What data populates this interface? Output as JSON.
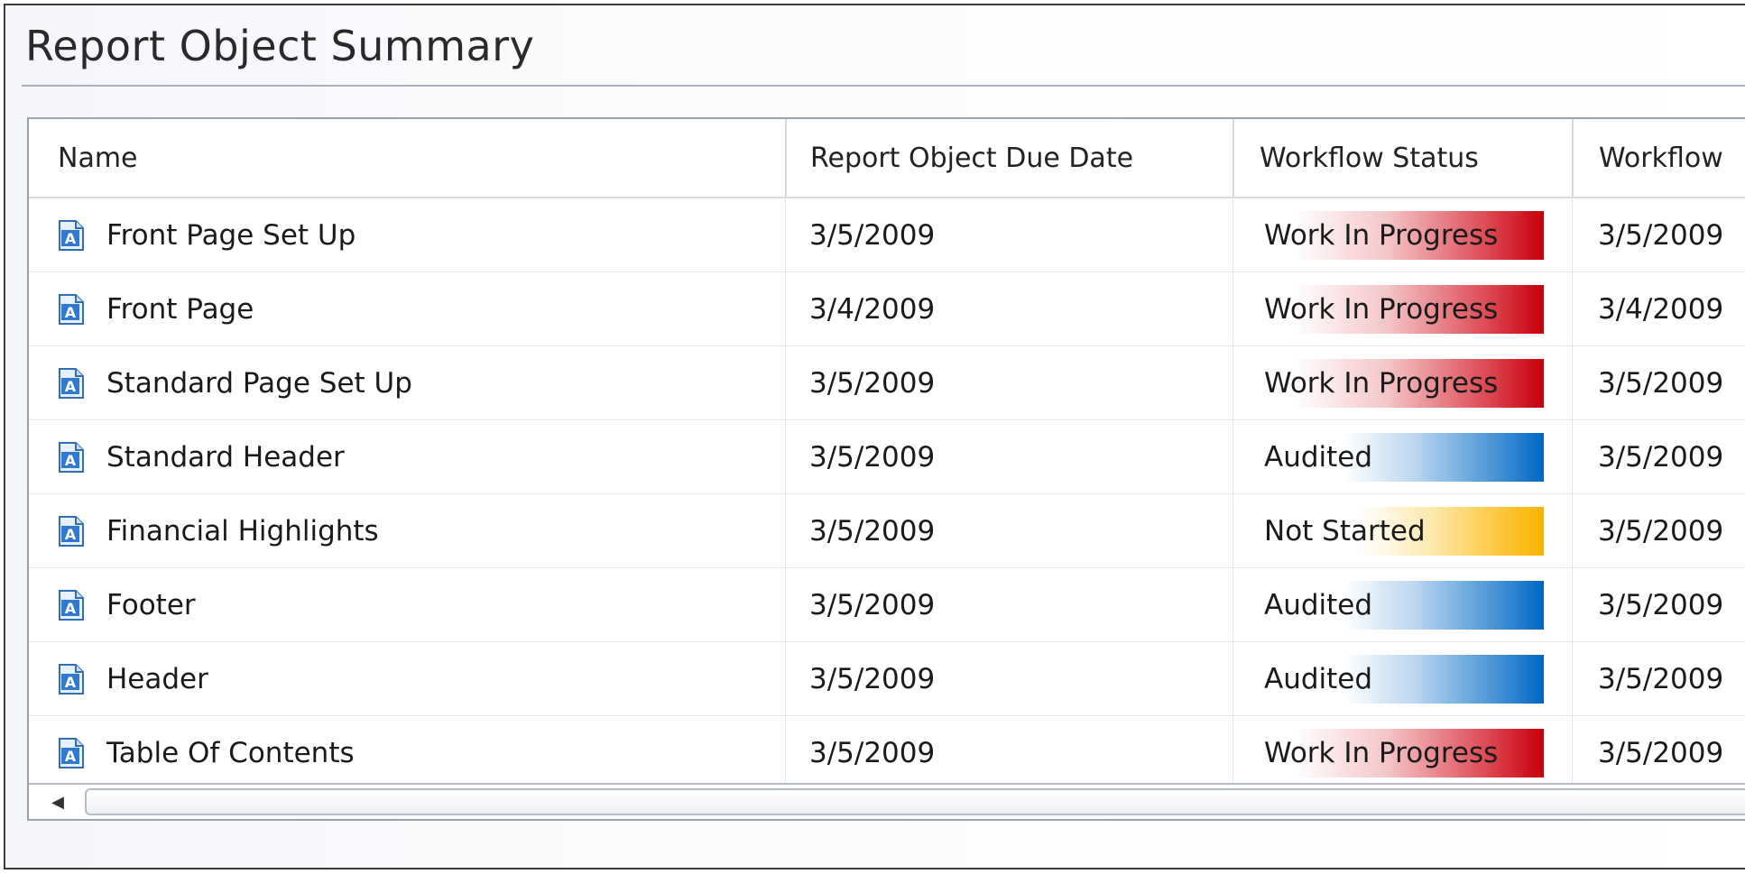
{
  "panel": {
    "title": "Report Object Summary"
  },
  "columns": {
    "name": "Name",
    "due_date": "Report Object Due Date",
    "status": "Workflow Status",
    "workflow": "Workflow"
  },
  "rows": [
    {
      "name": "Front Page Set Up",
      "due_date": "3/5/2009",
      "status": "Work In Progress",
      "workflow": "3/5/2009",
      "status_color": "#c4000b"
    },
    {
      "name": "Front Page",
      "due_date": "3/4/2009",
      "status": "Work In Progress",
      "workflow": "3/4/2009",
      "status_color": "#c4000b"
    },
    {
      "name": "Standard Page Set Up",
      "due_date": "3/5/2009",
      "status": "Work In Progress",
      "workflow": "3/5/2009",
      "status_color": "#c4000b"
    },
    {
      "name": "Standard Header",
      "due_date": "3/5/2009",
      "status": "Audited",
      "workflow": "3/5/2009",
      "status_color": "#0066c2"
    },
    {
      "name": "Financial Highlights",
      "due_date": "3/5/2009",
      "status": "Not Started",
      "workflow": "3/5/2009",
      "status_color": "#f7b400"
    },
    {
      "name": "Footer",
      "due_date": "3/5/2009",
      "status": "Audited",
      "workflow": "3/5/2009",
      "status_color": "#0066c2"
    },
    {
      "name": "Header",
      "due_date": "3/5/2009",
      "status": "Audited",
      "workflow": "3/5/2009",
      "status_color": "#0066c2"
    },
    {
      "name": "Table Of Contents",
      "due_date": "3/5/2009",
      "status": "Work In Progress",
      "workflow": "3/5/2009",
      "status_color": "#c4000b"
    }
  ],
  "icons": {
    "row_icon": "report-document-icon",
    "scroll_left": "scroll-left-arrow-icon"
  }
}
